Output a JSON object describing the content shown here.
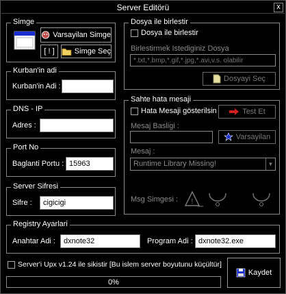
{
  "window": {
    "title": "Server Editörü",
    "close_label": "x"
  },
  "simge": {
    "legend": "Simge",
    "default_button": "Varsayilan Simge",
    "bracket_button": "[ ! ]",
    "select_button": "Simge Seç"
  },
  "kurban": {
    "legend": "Kurban'in adi",
    "label": "Kurban'in Adi :",
    "value": ""
  },
  "dns": {
    "legend": "DNS - IP",
    "label": "Adres :",
    "value": ""
  },
  "port": {
    "legend": "Port No",
    "label": "Baglanti Portu :",
    "value": "15963"
  },
  "sifre": {
    "legend": "Server Sifresi",
    "label": "Sifre :",
    "value": "cigicigi"
  },
  "dosya": {
    "legend": "Dosya ile birlestir",
    "checkbox_label": "Dosya ile birlestir",
    "hint_label": "Birlestirmek Istediginiz Dosya",
    "placeholder": "*.txt,*.bmp,*.gif,*.jpg,*.avi,v.s. olabilir",
    "select_button": "Dosyayi Seç"
  },
  "sahte": {
    "legend": "Sahte hata mesaji",
    "checkbox_label": "Hata Mesaji gösterilsin",
    "test_button": "Test Et",
    "baslik_label": "Mesaj Basligi :",
    "default_button": "Varsayilan",
    "mesaj_label": "Mesaj :",
    "mesaj_value": "Runtime Library Missing!",
    "simgesi_label": "Msg Simgesi :"
  },
  "registry": {
    "legend": "Registry Ayarlari",
    "key_label": "Anahtar Adi :",
    "key_value": "dxnote32",
    "program_label": "Program Adi :",
    "program_value": "dxnote32.exe"
  },
  "upx": {
    "checkbox_label": "Server'i Upx v1.24 ile sikistir [Bu islem server boyutunu küçültür]"
  },
  "progress": {
    "value": 0,
    "text": "0%"
  },
  "save_button": "Kaydet",
  "colors": {
    "background": "#000000",
    "field": "#ffffff",
    "border": "#8a8a8a",
    "progress_fill": "#2b5cd6"
  }
}
